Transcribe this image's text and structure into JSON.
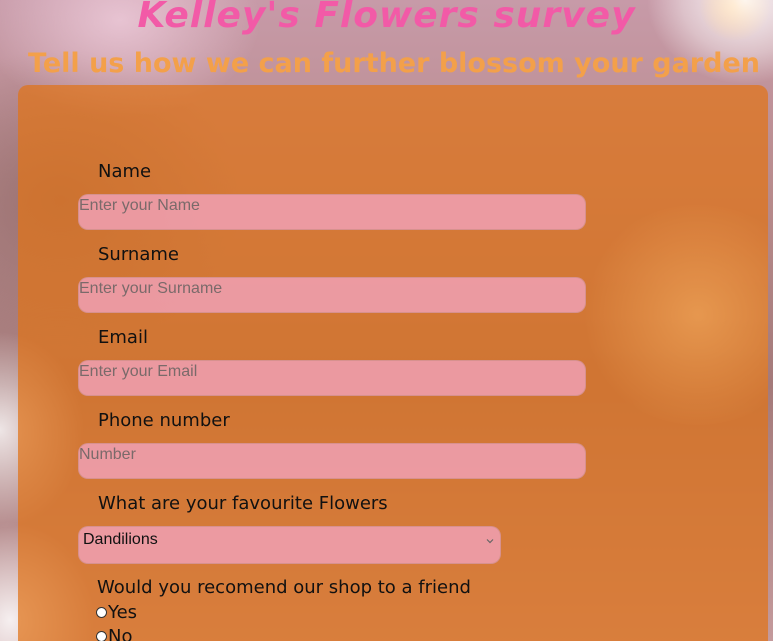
{
  "header": {
    "title": "Kelley's Flowers survey",
    "subtitle": "Tell us how we can further blossom your garden"
  },
  "form": {
    "name": {
      "label": "Name",
      "placeholder": "Enter your Name",
      "value": ""
    },
    "surname": {
      "label": "Surname",
      "placeholder": "Enter your Surname",
      "value": ""
    },
    "email": {
      "label": "Email",
      "placeholder": "Enter your Email",
      "value": ""
    },
    "phone": {
      "label": "Phone number",
      "placeholder": "Number",
      "value": ""
    },
    "flowers": {
      "label": "What are your favourite Flowers",
      "selected": "Dandilions"
    },
    "recommend": {
      "label": "Would you recomend our shop to a friend",
      "options": [
        "Yes",
        "No"
      ]
    }
  },
  "colors": {
    "title": "#f25aa7",
    "subtitle": "#f3a04a",
    "panel": "#e07318",
    "input_bg": "#f0a0b4"
  },
  "icons": {
    "select_chevron": "chevron-down-icon",
    "radio": "radio-button-icon"
  }
}
